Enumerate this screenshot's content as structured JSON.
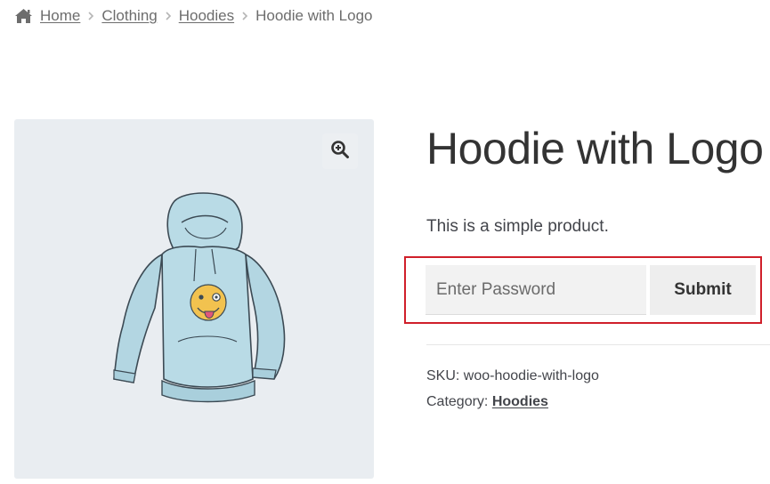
{
  "breadcrumb": {
    "home_label": "Home",
    "items": [
      "Clothing",
      "Hoodies"
    ],
    "current": "Hoodie with Logo",
    "home_icon": "home-icon",
    "separator_icon": "chevron-right-icon"
  },
  "gallery": {
    "zoom_icon": "zoom-in-icon",
    "image": "hoodie-with-logo-illustration",
    "background_color": "#e9edf1"
  },
  "product": {
    "title": "Hoodie with Logo",
    "short_description": "This is a simple product."
  },
  "password_form": {
    "placeholder": "Enter Password",
    "value": "",
    "submit_label": "Submit",
    "highlight_color": "#d01f2a"
  },
  "meta": {
    "sku_label": "SKU:",
    "sku_value": "woo-hoodie-with-logo",
    "category_label": "Category:",
    "category_value": "Hoodies"
  }
}
